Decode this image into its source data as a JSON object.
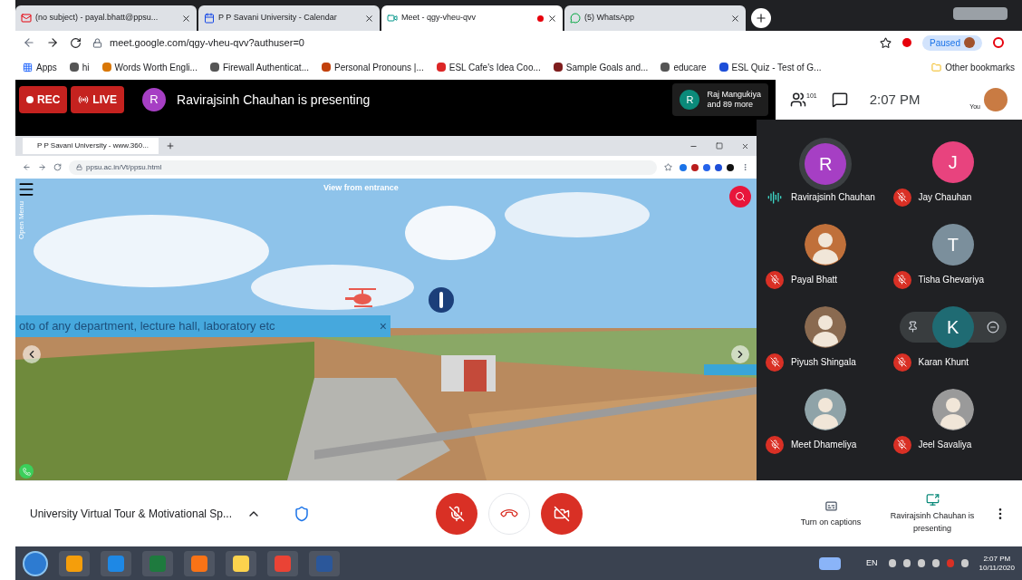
{
  "browser": {
    "tabs": [
      {
        "title": "(no subject) - payal.bhatt@ppsu...",
        "selected": false,
        "recording": false
      },
      {
        "title": "P P Savani University - Calendar",
        "selected": false,
        "recording": false
      },
      {
        "title": "Meet - qgy-vheu-qvv",
        "selected": true,
        "recording": true
      },
      {
        "title": "(5) WhatsApp",
        "selected": false,
        "recording": false
      }
    ],
    "address": "meet.google.com/qgy-vheu-qvv?authuser=0",
    "profile": "Paused",
    "bookmarks": [
      "Apps",
      "hi",
      "Words Worth Engli...",
      "Firewall Authenticat...",
      "Personal Pronouns |...",
      "ESL Cafe's Idea Coo...",
      "Sample Goals and...",
      "educare",
      "ESL Quiz - Test of G..."
    ],
    "other_bookmarks": "Other bookmarks"
  },
  "meet": {
    "rec": "REC",
    "live": "LIVE",
    "presenter_initial": "R",
    "presenting": "Ravirajsinh Chauhan is presenting",
    "hand": {
      "initial": "R",
      "name": "Raj Mangukiya",
      "more": "and 89 more"
    },
    "people_count": "101",
    "time": "2:07 PM",
    "you": "You",
    "shared": {
      "tab_title": "P P Savani University - www.360...",
      "url": "ppsu.ac.in/Vt/ppsu.html",
      "view_title": "View from entrance",
      "menu_label": "Open Menu",
      "banner": "oto of any department, lecture hall, laboratory etc",
      "banner_close": "×"
    },
    "participant_rows": [
      {
        "participants": [
          {
            "name": "Ravirajsinh Chauhan",
            "initial": "R",
            "color": "#a63fc4",
            "photo": false,
            "muted": false,
            "speaking": true,
            "hovered": false
          },
          {
            "name": "Jay Chauhan",
            "initial": "J",
            "color": "#e8437e",
            "photo": false,
            "muted": true,
            "speaking": false,
            "hovered": false
          }
        ]
      },
      {
        "participants": [
          {
            "name": "Payal Bhatt",
            "color": "#c0703a",
            "photo": true,
            "muted": true,
            "speaking": false,
            "hovered": false
          },
          {
            "name": "Tisha Ghevariya",
            "initial": "T",
            "color": "#7b8f9c",
            "photo": false,
            "muted": true,
            "speaking": false,
            "hovered": false
          }
        ]
      },
      {
        "participants": [
          {
            "name": "Piyush Shingala",
            "color": "#8a6a50",
            "photo": true,
            "muted": true,
            "speaking": false,
            "hovered": false
          },
          {
            "name": "Karan Khunt",
            "initial": "K",
            "color": "#1f6b73",
            "photo": false,
            "muted": true,
            "speaking": false,
            "hovered": true
          }
        ]
      },
      {
        "participants": [
          {
            "name": "Meet Dhameliya",
            "color": "#8fa3a8",
            "photo": true,
            "muted": true,
            "speaking": false,
            "hovered": false
          },
          {
            "name": "Jeel Savaliya",
            "color": "#9a9a9a",
            "photo": true,
            "muted": true,
            "speaking": false,
            "hovered": false
          }
        ]
      }
    ],
    "meeting_title": "University Virtual Tour & Motivational Sp...",
    "mic_on": false,
    "camera_on": false,
    "captions": "Turn on captions",
    "presenting_button": "Ravirajsinh Chauhan is presenting"
  },
  "taskbar": {
    "language": "EN",
    "time": "2:07 PM",
    "date": "10/11/2020"
  }
}
